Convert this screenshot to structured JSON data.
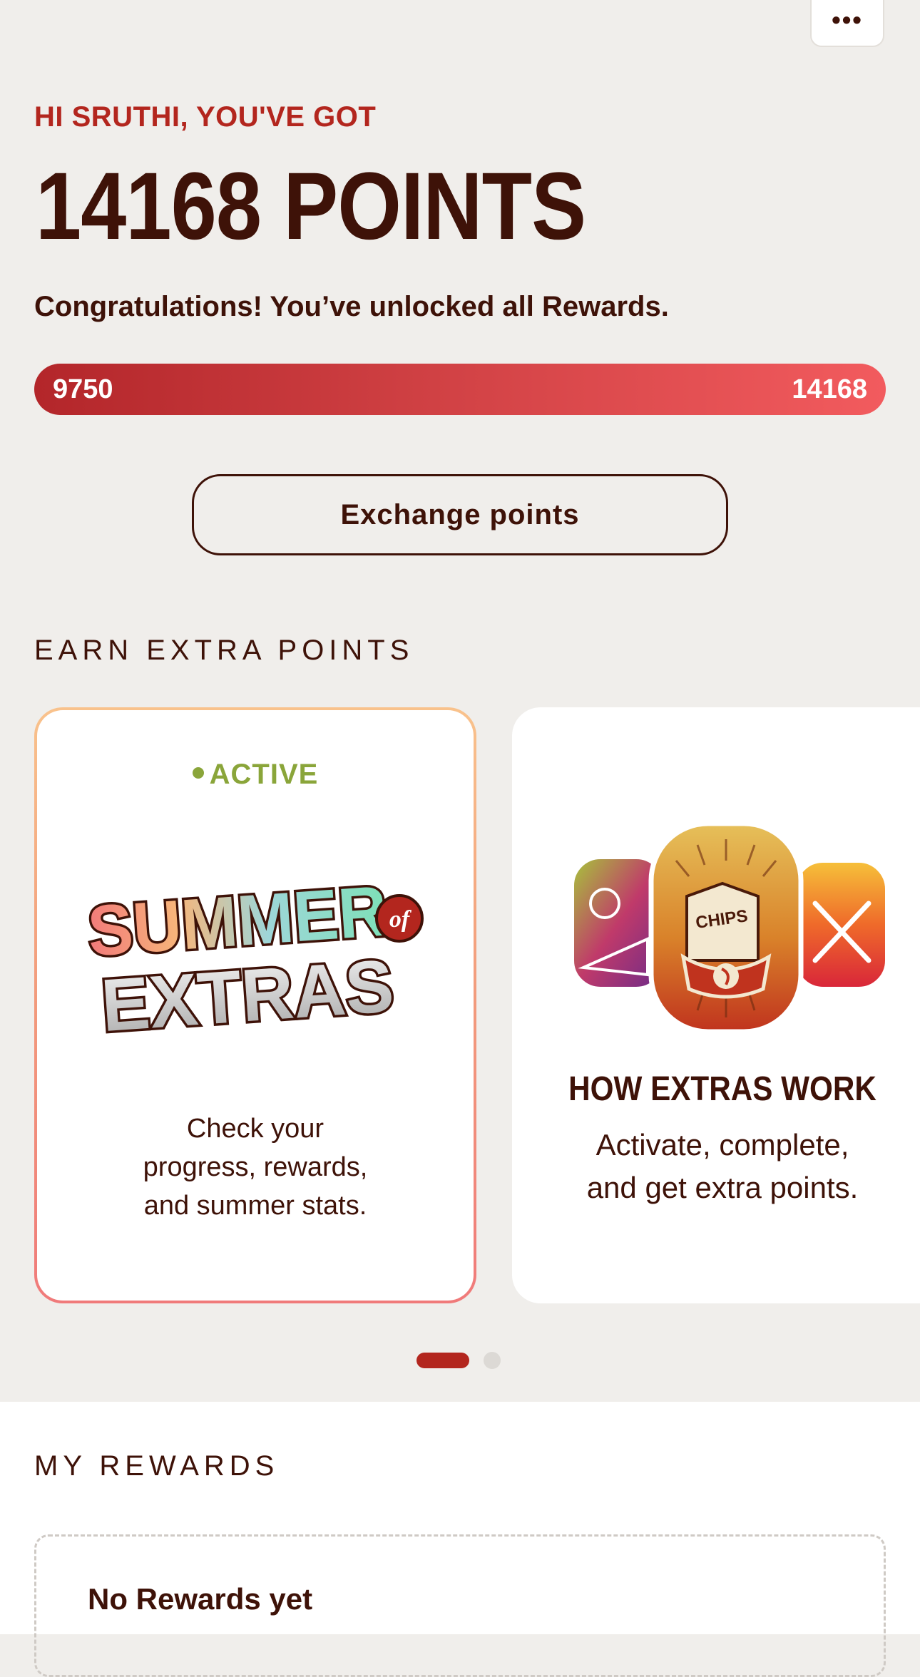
{
  "header": {
    "more_label": "•••",
    "greeting": "HI SRUTHI, YOU'VE GOT",
    "points_text": "14168 POINTS",
    "congrats": "Congratulations! You’ve unlocked all Rewards."
  },
  "progress": {
    "start_label": "9750",
    "end_label": "14168",
    "fill_fraction": 1.0
  },
  "exchange_button": {
    "label": "Exchange points"
  },
  "earn_section": {
    "title": "EARN EXTRA POINTS",
    "cards": [
      {
        "badge": "ACTIVE",
        "logo_top": "SUMMER",
        "logo_bottom": "EXTRAS",
        "logo_of": "of",
        "description_lines": [
          "Check your",
          "progress, rewards,",
          "and summer stats."
        ]
      },
      {
        "art_label": "CHIPS",
        "title": "HOW EXTRAS WORK",
        "description_lines": [
          "Activate, complete,",
          "and get extra points."
        ]
      }
    ],
    "pager": {
      "count": 2,
      "active_index": 0
    }
  },
  "rewards_section": {
    "title": "MY REWARDS",
    "empty_text": "No Rewards yet"
  },
  "colors": {
    "brand_red": "#b3261e",
    "brown_text": "#3e1208",
    "active_green": "#8aa53a",
    "background": "#f0eeeb"
  }
}
